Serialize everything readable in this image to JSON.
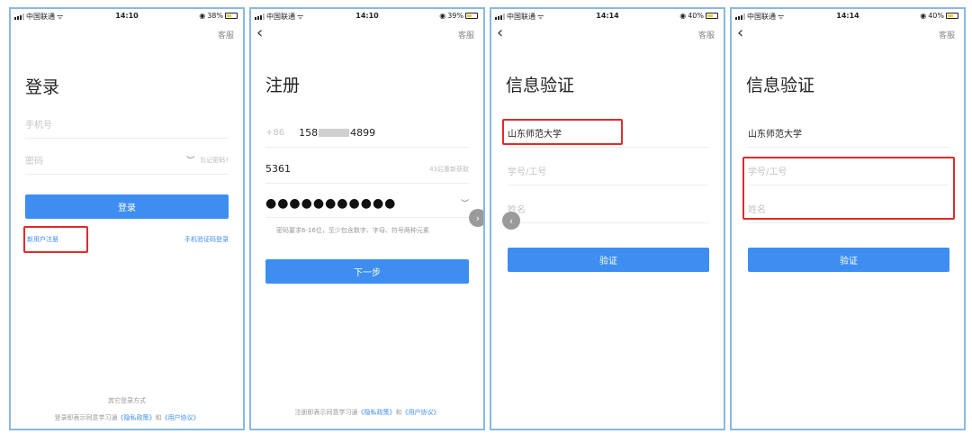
{
  "status": {
    "carrier": "中国联通",
    "p1": {
      "time": "14:10",
      "battery": "38%"
    },
    "p2": {
      "time": "14:10",
      "battery": "39%"
    },
    "p3": {
      "time": "14:14",
      "battery": "40%"
    },
    "p4": {
      "time": "14:14",
      "battery": "40%"
    }
  },
  "common": {
    "service": "客服",
    "back_icon": "chevron-left-icon"
  },
  "login": {
    "title": "登录",
    "phone_placeholder": "手机号",
    "password_placeholder": "密码",
    "forgot": "忘记密码?",
    "login_button": "登录",
    "register_link": "新用户注册",
    "sms_login_link": "手机验证码登录",
    "other_methods": "其它登录方式",
    "agree_prefix": "登录即表示同意学习通",
    "privacy": "《隐私政策》",
    "and": "和",
    "user_agreement": "《用户协议》"
  },
  "register": {
    "title": "注册",
    "country_code": "+86",
    "phone_prefix": "158",
    "phone_suffix": "4899",
    "code_value": "5361",
    "resend": "43后重新获取",
    "password_dots": "●●●●●●●●●●●",
    "hint": "密码要求6-16位，至少包含数字、字母、符号两种元素",
    "next_button": "下一步",
    "agree_prefix": "注册即表示同意学习通",
    "privacy": "《隐私政策》",
    "and": "和",
    "user_agreement": "《用户协议》"
  },
  "verify": {
    "title": "信息验证",
    "school": "山东师范大学",
    "id_placeholder": "学号/工号",
    "name_placeholder": "姓名",
    "verify_button": "验证"
  },
  "colors": {
    "accent": "#3d8ef0",
    "highlight": "#e02b2b",
    "border": "#8ab8e0"
  }
}
